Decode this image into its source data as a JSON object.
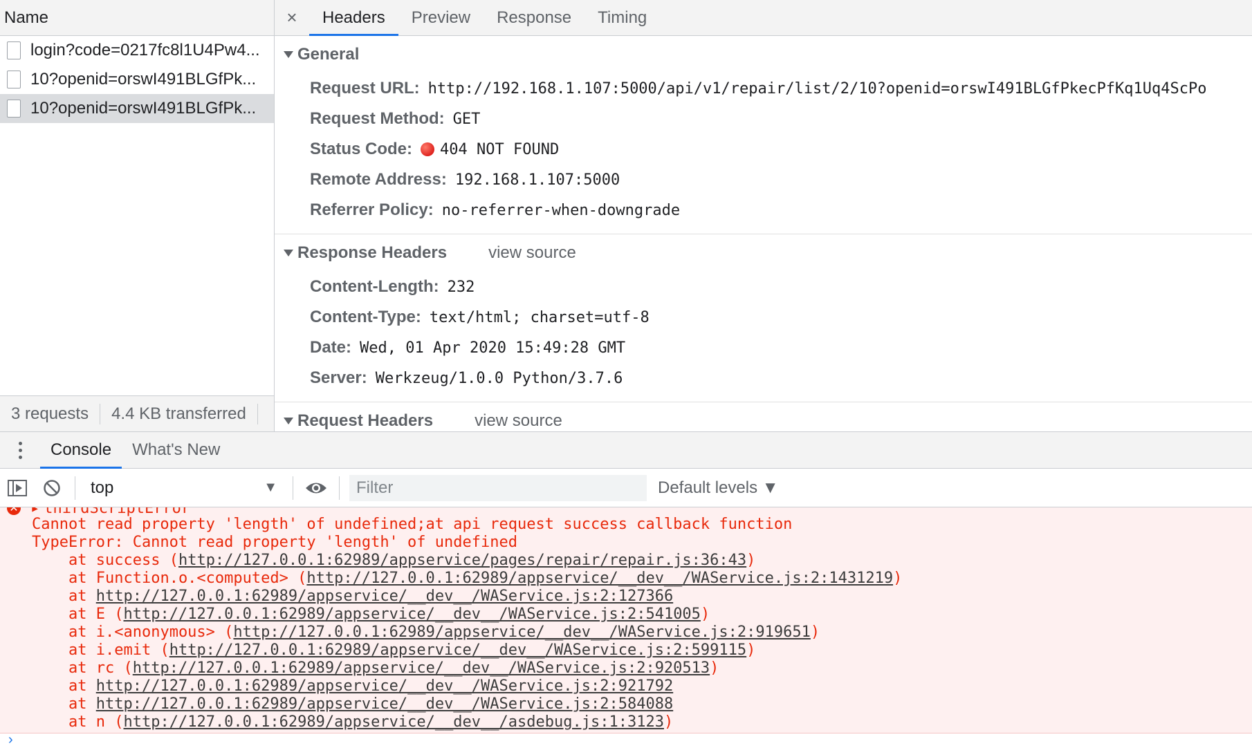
{
  "network": {
    "name_header": "Name",
    "requests": [
      {
        "name": "login?code=0217fc8l1U4Pw4..."
      },
      {
        "name": "10?openid=orswI491BLGfPk..."
      },
      {
        "name": "10?openid=orswI491BLGfPk..."
      }
    ],
    "status": {
      "requests": "3 requests",
      "transferred": "4.4 KB transferred"
    }
  },
  "details": {
    "close_glyph": "×",
    "tabs": [
      "Headers",
      "Preview",
      "Response",
      "Timing"
    ],
    "active_tab": "Headers",
    "general": {
      "title": "General",
      "rows": [
        {
          "key": "Request URL:",
          "value": "http://192.168.1.107:5000/api/v1/repair/list/2/10?openid=orswI491BLGfPkecPfKq1Uq4ScPo"
        },
        {
          "key": "Request Method:",
          "value": "GET"
        },
        {
          "key": "Status Code:",
          "value": "404 NOT FOUND"
        },
        {
          "key": "Remote Address:",
          "value": "192.168.1.107:5000"
        },
        {
          "key": "Referrer Policy:",
          "value": "no-referrer-when-downgrade"
        }
      ]
    },
    "response_headers": {
      "title": "Response Headers",
      "view_source": "view source",
      "rows": [
        {
          "key": "Content-Length:",
          "value": "232"
        },
        {
          "key": "Content-Type:",
          "value": "text/html; charset=utf-8"
        },
        {
          "key": "Date:",
          "value": "Wed, 01 Apr 2020 15:49:28 GMT"
        },
        {
          "key": "Server:",
          "value": "Werkzeug/1.0.0 Python/3.7.6"
        }
      ]
    },
    "request_headers": {
      "title": "Request Headers",
      "view_source": "view source"
    }
  },
  "drawer": {
    "tabs": [
      "Console",
      "What's New"
    ],
    "active_tab": "Console"
  },
  "console_toolbar": {
    "context": "top",
    "filter_placeholder": "Filter",
    "levels": "Default levels ▼"
  },
  "console": {
    "error_title": "thirdScriptError",
    "message": "Cannot read property 'length' of undefined;at api request success callback function",
    "error_type": "TypeError: Cannot read property 'length' of undefined",
    "stack": [
      {
        "prefix": "at success (",
        "link": "http://127.0.0.1:62989/appservice/pages/repair/repair.js:36:43",
        "suffix": ")"
      },
      {
        "prefix": "at Function.o.<computed> (",
        "link": "http://127.0.0.1:62989/appservice/__dev__/WAService.js:2:1431219",
        "suffix": ")"
      },
      {
        "prefix": "at ",
        "link": "http://127.0.0.1:62989/appservice/__dev__/WAService.js:2:127366",
        "suffix": ""
      },
      {
        "prefix": "at E (",
        "link": "http://127.0.0.1:62989/appservice/__dev__/WAService.js:2:541005",
        "suffix": ")"
      },
      {
        "prefix": "at i.<anonymous> (",
        "link": "http://127.0.0.1:62989/appservice/__dev__/WAService.js:2:919651",
        "suffix": ")"
      },
      {
        "prefix": "at i.emit (",
        "link": "http://127.0.0.1:62989/appservice/__dev__/WAService.js:2:599115",
        "suffix": ")"
      },
      {
        "prefix": "at rc (",
        "link": "http://127.0.0.1:62989/appservice/__dev__/WAService.js:2:920513",
        "suffix": ")"
      },
      {
        "prefix": "at ",
        "link": "http://127.0.0.1:62989/appservice/__dev__/WAService.js:2:921792",
        "suffix": ""
      },
      {
        "prefix": "at ",
        "link": "http://127.0.0.1:62989/appservice/__dev__/WAService.js:2:584088",
        "suffix": ""
      },
      {
        "prefix": "at n (",
        "link": "http://127.0.0.1:62989/appservice/__dev__/asdebug.js:1:3123",
        "suffix": ")"
      }
    ]
  },
  "colors": {
    "accent": "#1a73e8",
    "error": "#e8290b",
    "error_bg": "#fef0f0"
  }
}
